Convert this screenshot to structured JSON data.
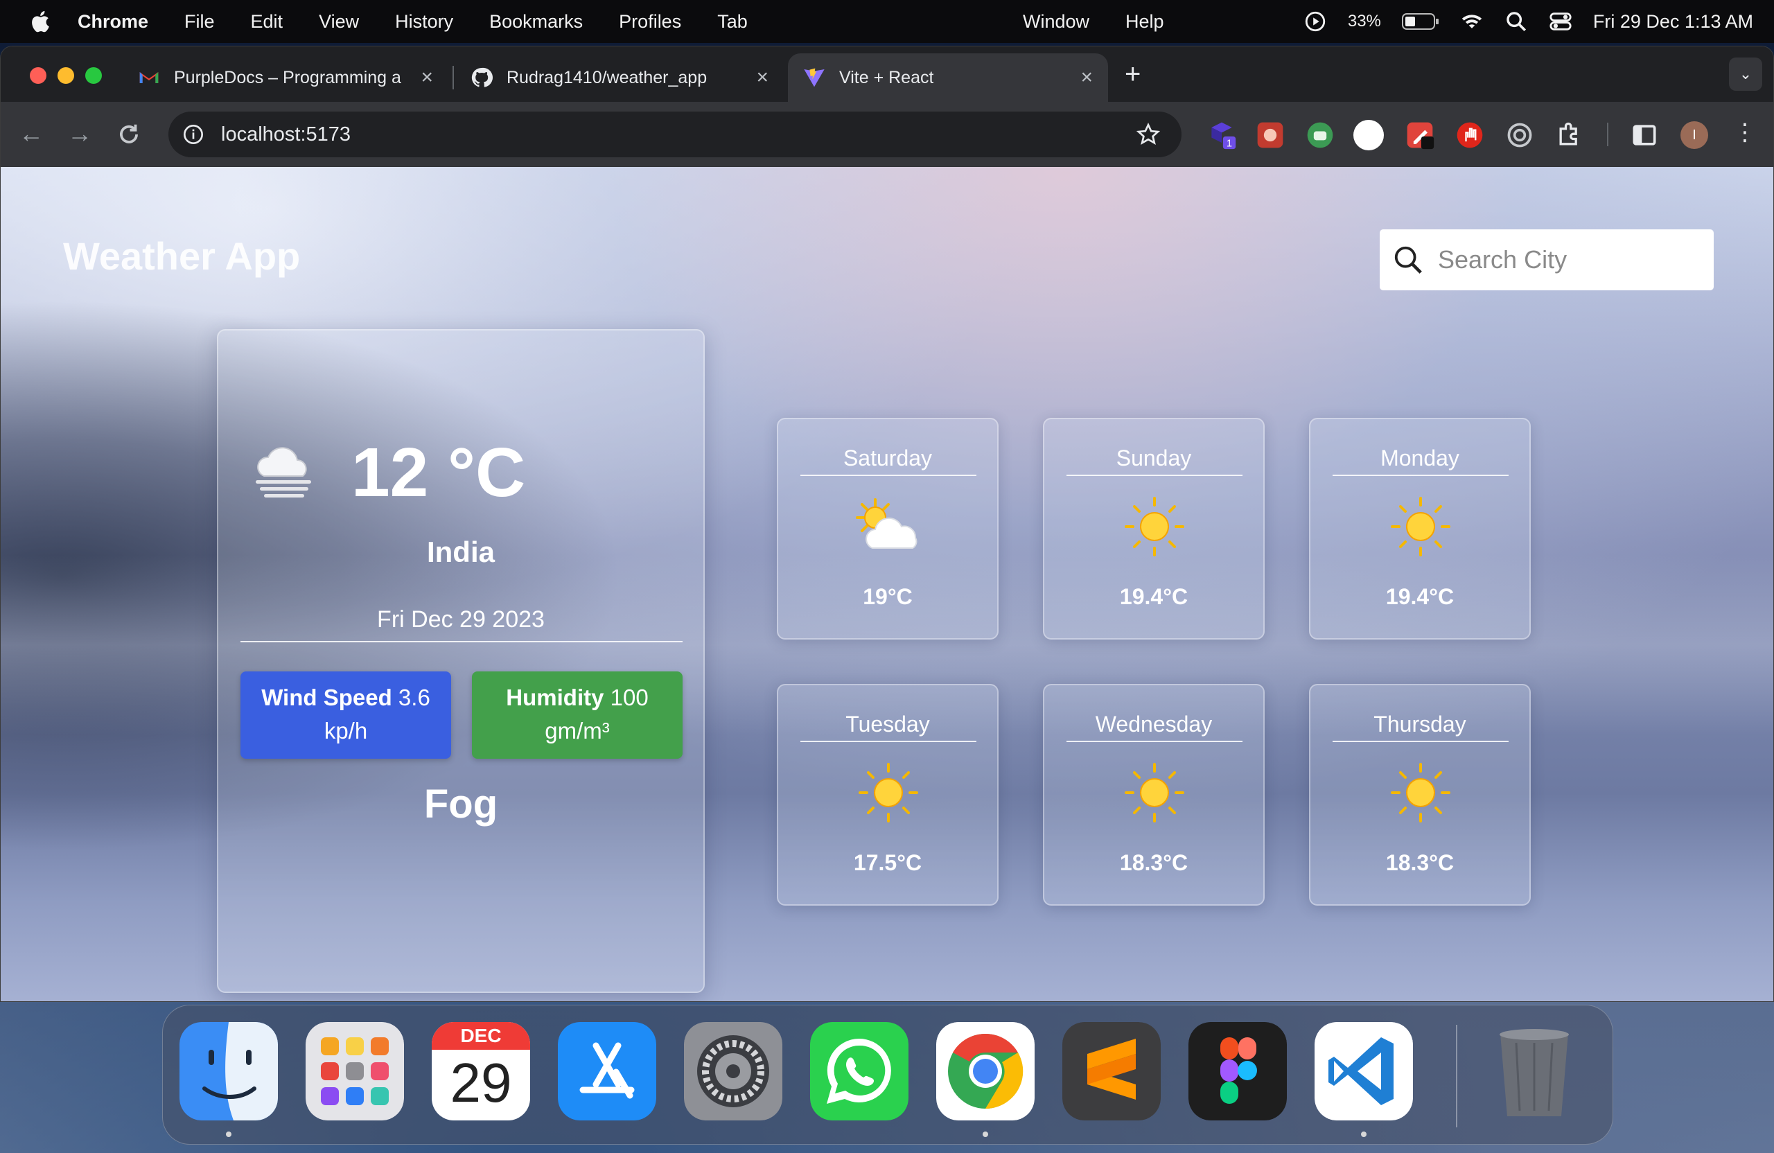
{
  "menubar": {
    "app": "Chrome",
    "items": [
      "File",
      "Edit",
      "View",
      "History",
      "Bookmarks",
      "Profiles",
      "Tab"
    ],
    "items_right": [
      "Window",
      "Help"
    ],
    "battery": "33%",
    "clock": "Fri 29 Dec  1:13 AM"
  },
  "browser": {
    "tabs": [
      {
        "label": "PurpleDocs – Programming a",
        "icon": "gmail-icon",
        "active": false
      },
      {
        "label": "Rudrag1410/weather_app",
        "icon": "github-icon",
        "active": false
      },
      {
        "label": "Vite + React",
        "icon": "vite-icon",
        "active": true
      }
    ],
    "url": "localhost:5173",
    "profile_initial": "I"
  },
  "app": {
    "title": "Weather App",
    "search_placeholder": "Search City",
    "current": {
      "temperature": "12 °C",
      "location": "India",
      "date": "Fri Dec 29 2023",
      "wind_label": "Wind Speed",
      "wind_value": "3.6",
      "wind_unit": "kp/h",
      "humidity_label": "Humidity",
      "humidity_value": "100",
      "humidity_unit": "gm/m³",
      "condition": "Fog"
    },
    "forecast": [
      {
        "day": "Saturday",
        "temp": "19°C",
        "icon": "sun-cloud-icon"
      },
      {
        "day": "Sunday",
        "temp": "19.4°C",
        "icon": "sun-icon"
      },
      {
        "day": "Monday",
        "temp": "19.4°C",
        "icon": "sun-icon"
      },
      {
        "day": "Tuesday",
        "temp": "17.5°C",
        "icon": "sun-icon"
      },
      {
        "day": "Wednesday",
        "temp": "18.3°C",
        "icon": "sun-icon"
      },
      {
        "day": "Thursday",
        "temp": "18.3°C",
        "icon": "sun-icon"
      }
    ],
    "colors": {
      "wind": "#3a5fe0",
      "humidity": "#43a04b"
    }
  },
  "dock": {
    "calendar_month": "DEC",
    "calendar_day": "29",
    "apps": [
      "finder-icon",
      "launchpad-icon",
      "calendar-icon",
      "app-store-icon",
      "system-settings-icon",
      "whatsapp-icon",
      "chrome-icon",
      "sublime-text-icon",
      "figma-icon",
      "vscode-icon",
      "trash-icon"
    ]
  }
}
